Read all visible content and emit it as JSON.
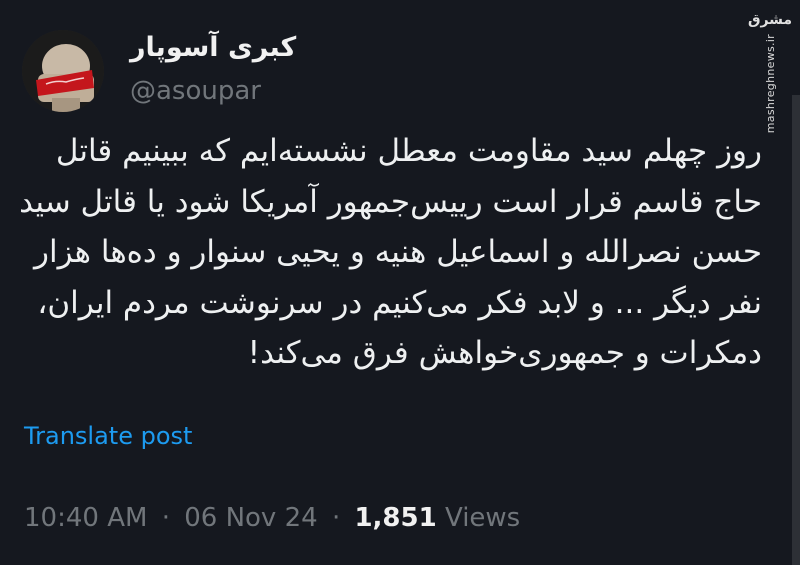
{
  "author": {
    "display_name": "کبری آسوپار",
    "handle": "@asoupar",
    "avatar_icon": "avatar-image"
  },
  "watermark": {
    "logo_text": "مشرق",
    "site": "mashreghnews.ir"
  },
  "tweet": {
    "lines": [
      "روز چهلم سید مقاومت معطل نشسته‌ایم که ببینیم قاتل",
      "حاج قاسم قرار است رییس‌جمهور آمریکا شود یا قاتل سید",
      "حسن نصرالله و اسماعیل هنیه و یحیی سنوار و ده‌ها هزار",
      "نفر دیگر ... و لابد فکر می‌کنیم در سرنوشت مردم ایران،",
      "دمکرات و جمهوری‌خواهش فرق می‌کند!"
    ],
    "translate_label": "Translate post"
  },
  "meta": {
    "time": "10:40 AM",
    "separator": "·",
    "date": "06 Nov 24",
    "views_count": "1,851",
    "views_label": "Views"
  },
  "colors": {
    "background": "#15181f",
    "text": "#e7e9ea",
    "muted": "#71767b",
    "link": "#1d9bf0",
    "avatar_band": "#c4161c"
  }
}
